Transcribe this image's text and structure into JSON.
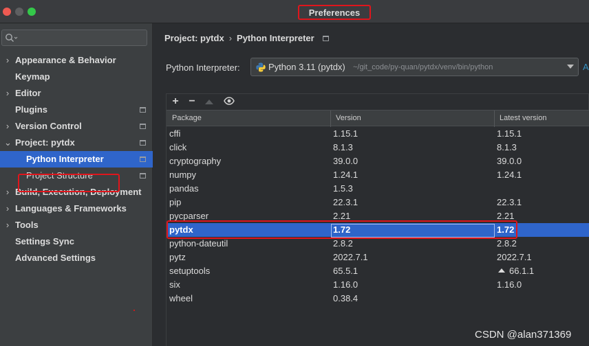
{
  "window": {
    "title": "Preferences"
  },
  "search": {
    "placeholder": ""
  },
  "sidebar": {
    "items": [
      {
        "label": "Appearance & Behavior",
        "arrow": "›",
        "sub": false
      },
      {
        "label": "Keymap",
        "arrow": "",
        "sub": false
      },
      {
        "label": "Editor",
        "arrow": "›",
        "sub": false
      },
      {
        "label": "Plugins",
        "arrow": "",
        "sub": false,
        "project_icon": true
      },
      {
        "label": "Version Control",
        "arrow": "›",
        "sub": false,
        "project_icon": true
      },
      {
        "label": "Project: pytdx",
        "arrow": "⌄",
        "sub": false,
        "project_icon": true
      },
      {
        "label": "Python Interpreter",
        "arrow": "",
        "sub": true,
        "selected": true,
        "project_icon": true
      },
      {
        "label": "Project Structure",
        "arrow": "",
        "sub": true,
        "project_icon": true
      },
      {
        "label": "Build, Execution, Deployment",
        "arrow": "›",
        "sub": false
      },
      {
        "label": "Languages & Frameworks",
        "arrow": "›",
        "sub": false
      },
      {
        "label": "Tools",
        "arrow": "›",
        "sub": false
      },
      {
        "label": "Settings Sync",
        "arrow": "",
        "sub": false
      },
      {
        "label": "Advanced Settings",
        "arrow": "",
        "sub": false
      }
    ]
  },
  "breadcrumb": {
    "project": "Project: pytdx",
    "separator": "›",
    "page": "Python Interpreter"
  },
  "interpreter": {
    "label": "Python Interpreter:",
    "name": "Python 3.11 (pytdx)",
    "path": "~/git_code/py-quan/pytdx/venv/bin/python",
    "add_link": "A"
  },
  "toolbar": {
    "add": "+",
    "remove": "−"
  },
  "table": {
    "columns": [
      "Package",
      "Version",
      "Latest version"
    ],
    "rows": [
      {
        "package": "cffi",
        "version": "1.15.1",
        "latest": "1.15.1"
      },
      {
        "package": "click",
        "version": "8.1.3",
        "latest": "8.1.3"
      },
      {
        "package": "cryptography",
        "version": "39.0.0",
        "latest": "39.0.0"
      },
      {
        "package": "numpy",
        "version": "1.24.1",
        "latest": "1.24.1"
      },
      {
        "package": "pandas",
        "version": "1.5.3",
        "latest": ""
      },
      {
        "package": "pip",
        "version": "22.3.1",
        "latest": "22.3.1"
      },
      {
        "package": "pycparser",
        "version": "2.21",
        "latest": "2.21"
      },
      {
        "package": "pytdx",
        "version": "1.72",
        "latest": "1.72",
        "selected": true
      },
      {
        "package": "python-dateutil",
        "version": "2.8.2",
        "latest": "2.8.2"
      },
      {
        "package": "pytz",
        "version": "2022.7.1",
        "latest": "2022.7.1"
      },
      {
        "package": "setuptools",
        "version": "65.5.1",
        "latest": "66.1.1",
        "upgrade": true
      },
      {
        "package": "six",
        "version": "1.16.0",
        "latest": "1.16.0"
      },
      {
        "package": "wheel",
        "version": "0.38.4",
        "latest": ""
      }
    ]
  },
  "watermark": "CSDN @alan371369",
  "colors": {
    "selection": "#2f65ca",
    "annotation_red": "#e0151c",
    "link": "#3592c4"
  }
}
